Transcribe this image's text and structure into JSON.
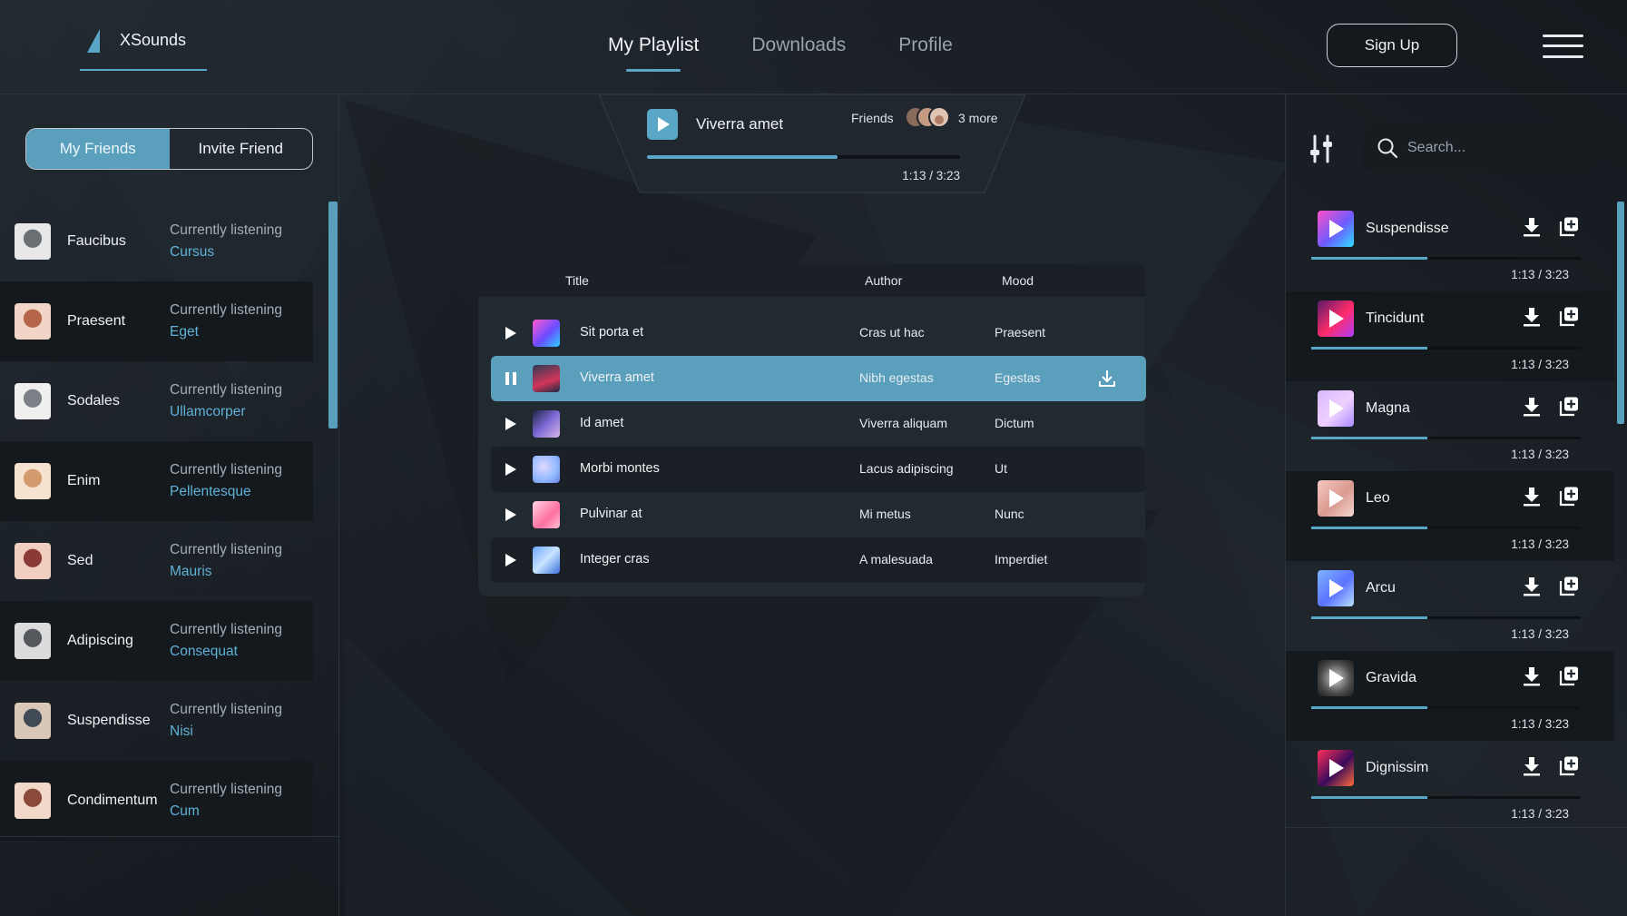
{
  "app": {
    "name": "XSounds"
  },
  "nav": {
    "tabs": [
      {
        "label": "My Playlist",
        "active": true
      },
      {
        "label": "Downloads",
        "active": false
      },
      {
        "label": "Profile",
        "active": false
      }
    ],
    "signup_label": "Sign Up"
  },
  "friends_panel": {
    "tabs": [
      {
        "label": "My Friends",
        "active": true
      },
      {
        "label": "Invite Friend",
        "active": false
      }
    ],
    "status_label": "Currently listening",
    "friends": [
      {
        "name": "Faucibus",
        "track": "Cursus"
      },
      {
        "name": "Praesent",
        "track": "Eget"
      },
      {
        "name": "Sodales",
        "track": "Ullamcorper"
      },
      {
        "name": "Enim",
        "track": "Pellentesque"
      },
      {
        "name": "Sed",
        "track": "Mauris"
      },
      {
        "name": "Adipiscing",
        "track": "Consequat"
      },
      {
        "name": "Suspendisse",
        "track": "Nisi"
      },
      {
        "name": "Condimentum",
        "track": "Cum"
      }
    ]
  },
  "now_playing": {
    "title": "Viverra amet",
    "friends_label": "Friends",
    "more_label": "3 more",
    "time": "1:13 / 3:23",
    "progress": 0.61
  },
  "playlist": {
    "columns": {
      "title": "Title",
      "author": "Author",
      "mood": "Mood"
    },
    "rows": [
      {
        "title": "Sit porta et",
        "author": "Cras ut hac",
        "mood": "Praesent",
        "playing": false
      },
      {
        "title": "Viverra amet",
        "author": "Nibh egestas",
        "mood": "Egestas",
        "playing": true
      },
      {
        "title": "Id amet",
        "author": "Viverra aliquam",
        "mood": "Dictum",
        "playing": false
      },
      {
        "title": "Morbi montes",
        "author": "Lacus adipiscing",
        "mood": "Ut",
        "playing": false
      },
      {
        "title": "Pulvinar at",
        "author": "Mi metus",
        "mood": "Nunc",
        "playing": false
      },
      {
        "title": "Integer cras",
        "author": "A malesuada",
        "mood": "Imperdiet",
        "playing": false
      }
    ]
  },
  "search": {
    "placeholder": "Search..."
  },
  "songs": [
    {
      "name": "Suspendisse",
      "time": "1:13 / 3:23",
      "progress": 0.43
    },
    {
      "name": "Tincidunt",
      "time": "1:13 / 3:23",
      "progress": 0.43
    },
    {
      "name": "Magna",
      "time": "1:13 / 3:23",
      "progress": 0.43
    },
    {
      "name": "Leo",
      "time": "1:13 / 3:23",
      "progress": 0.43
    },
    {
      "name": "Arcu",
      "time": "1:13 / 3:23",
      "progress": 0.43
    },
    {
      "name": "Gravida",
      "time": "1:13 / 3:23",
      "progress": 0.43
    },
    {
      "name": "Dignissim",
      "time": "1:13 / 3:23",
      "progress": 0.43
    }
  ],
  "colors": {
    "accent": "#5aa6c6",
    "background": "#1c2228",
    "row_alt": "#14191e"
  }
}
